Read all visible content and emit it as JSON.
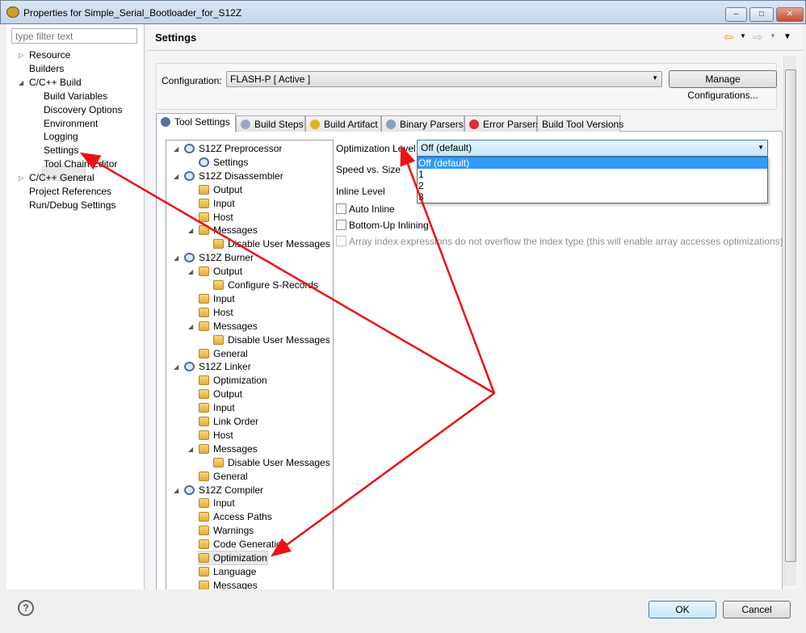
{
  "window": {
    "title": "Properties for Simple_Serial_Bootloader_for_S12Z",
    "minimize": "‒",
    "maximize": "□",
    "close": "✕"
  },
  "left": {
    "filter_placeholder": "type filter text",
    "items": [
      {
        "label": "Resource",
        "level": 0,
        "twisty": "▷"
      },
      {
        "label": "Builders",
        "level": 0,
        "twisty": ""
      },
      {
        "label": "C/C++ Build",
        "level": 0,
        "twisty": "◢"
      },
      {
        "label": "Build Variables",
        "level": 1,
        "twisty": ""
      },
      {
        "label": "Discovery Options",
        "level": 1,
        "twisty": ""
      },
      {
        "label": "Environment",
        "level": 1,
        "twisty": ""
      },
      {
        "label": "Logging",
        "level": 1,
        "twisty": ""
      },
      {
        "label": "Settings",
        "level": 1,
        "twisty": "",
        "selected": true
      },
      {
        "label": "Tool Chain Editor",
        "level": 1,
        "twisty": ""
      },
      {
        "label": "C/C++ General",
        "level": 0,
        "twisty": "▷"
      },
      {
        "label": "Project References",
        "level": 0,
        "twisty": ""
      },
      {
        "label": "Run/Debug Settings",
        "level": 0,
        "twisty": ""
      }
    ]
  },
  "header": {
    "title": "Settings",
    "back_icon": "arrow-left-icon",
    "forward_icon": "arrow-right-icon",
    "menu_icon": "chevron-down-icon"
  },
  "configuration": {
    "label": "Configuration:",
    "value": "FLASH-P  [ Active ]",
    "manage_button": "Manage Configurations..."
  },
  "tabs": [
    {
      "label": "Tool Settings",
      "icon": "gear-icon",
      "active": true
    },
    {
      "label": "Build Steps",
      "icon": "build-steps-icon"
    },
    {
      "label": "Build Artifact",
      "icon": "trophy-icon"
    },
    {
      "label": "Binary Parsers",
      "icon": "binary-icon"
    },
    {
      "label": "Error Parsers",
      "icon": "error-icon"
    },
    {
      "label": "Build Tool Versions",
      "icon": ""
    }
  ],
  "tree": [
    {
      "label": "S12Z Preprocessor",
      "level": 0,
      "icon": "gear",
      "exp": true
    },
    {
      "label": "Settings",
      "level": 1,
      "icon": "gear"
    },
    {
      "label": "S12Z Disassembler",
      "level": 0,
      "icon": "gear",
      "exp": true
    },
    {
      "label": "Output",
      "level": 1,
      "icon": "fold"
    },
    {
      "label": "Input",
      "level": 1,
      "icon": "fold"
    },
    {
      "label": "Host",
      "level": 1,
      "icon": "fold"
    },
    {
      "label": "Messages",
      "level": 1,
      "icon": "fold",
      "exp": true
    },
    {
      "label": "Disable User Messages",
      "level": 2,
      "icon": "fold"
    },
    {
      "label": "S12Z Burner",
      "level": 0,
      "icon": "gear",
      "exp": true
    },
    {
      "label": "Output",
      "level": 1,
      "icon": "fold",
      "exp": true
    },
    {
      "label": "Configure S-Records",
      "level": 2,
      "icon": "fold"
    },
    {
      "label": "Input",
      "level": 1,
      "icon": "fold"
    },
    {
      "label": "Host",
      "level": 1,
      "icon": "fold"
    },
    {
      "label": "Messages",
      "level": 1,
      "icon": "fold",
      "exp": true
    },
    {
      "label": "Disable User Messages",
      "level": 2,
      "icon": "fold"
    },
    {
      "label": "General",
      "level": 1,
      "icon": "fold"
    },
    {
      "label": "S12Z Linker",
      "level": 0,
      "icon": "gear",
      "exp": true
    },
    {
      "label": "Optimization",
      "level": 1,
      "icon": "fold"
    },
    {
      "label": "Output",
      "level": 1,
      "icon": "fold"
    },
    {
      "label": "Input",
      "level": 1,
      "icon": "fold"
    },
    {
      "label": "Link Order",
      "level": 1,
      "icon": "fold"
    },
    {
      "label": "Host",
      "level": 1,
      "icon": "fold"
    },
    {
      "label": "Messages",
      "level": 1,
      "icon": "fold",
      "exp": true
    },
    {
      "label": "Disable User Messages",
      "level": 2,
      "icon": "fold"
    },
    {
      "label": "General",
      "level": 1,
      "icon": "fold"
    },
    {
      "label": "S12Z Compiler",
      "level": 0,
      "icon": "gear",
      "exp": true
    },
    {
      "label": "Input",
      "level": 1,
      "icon": "fold"
    },
    {
      "label": "Access Paths",
      "level": 1,
      "icon": "fold"
    },
    {
      "label": "Warnings",
      "level": 1,
      "icon": "fold"
    },
    {
      "label": "Code Generation",
      "level": 1,
      "icon": "fold"
    },
    {
      "label": "Optimization",
      "level": 1,
      "icon": "fold",
      "selected": true
    },
    {
      "label": "Language",
      "level": 1,
      "icon": "fold"
    },
    {
      "label": "Messages",
      "level": 1,
      "icon": "fold"
    }
  ],
  "options": {
    "optimization_level_label": "Optimization Level",
    "optimization_level_value": "Off (default)",
    "dropdown_options": [
      "Off (default)",
      "1",
      "2",
      "3"
    ],
    "speed_vs_size_label": "Speed vs. Size",
    "inline_level_label": "Inline Level",
    "auto_inline": "Auto Inline",
    "bottom_up_inlining": "Bottom-Up Inlining",
    "array_index": "Array index expressions do not overflow the index type (this will enable array accesses optimizations)"
  },
  "footer": {
    "help": "?",
    "ok": "OK",
    "cancel": "Cancel"
  },
  "colors": {
    "annotation_arrow": "#ee1111",
    "selection": "#3399ff"
  }
}
